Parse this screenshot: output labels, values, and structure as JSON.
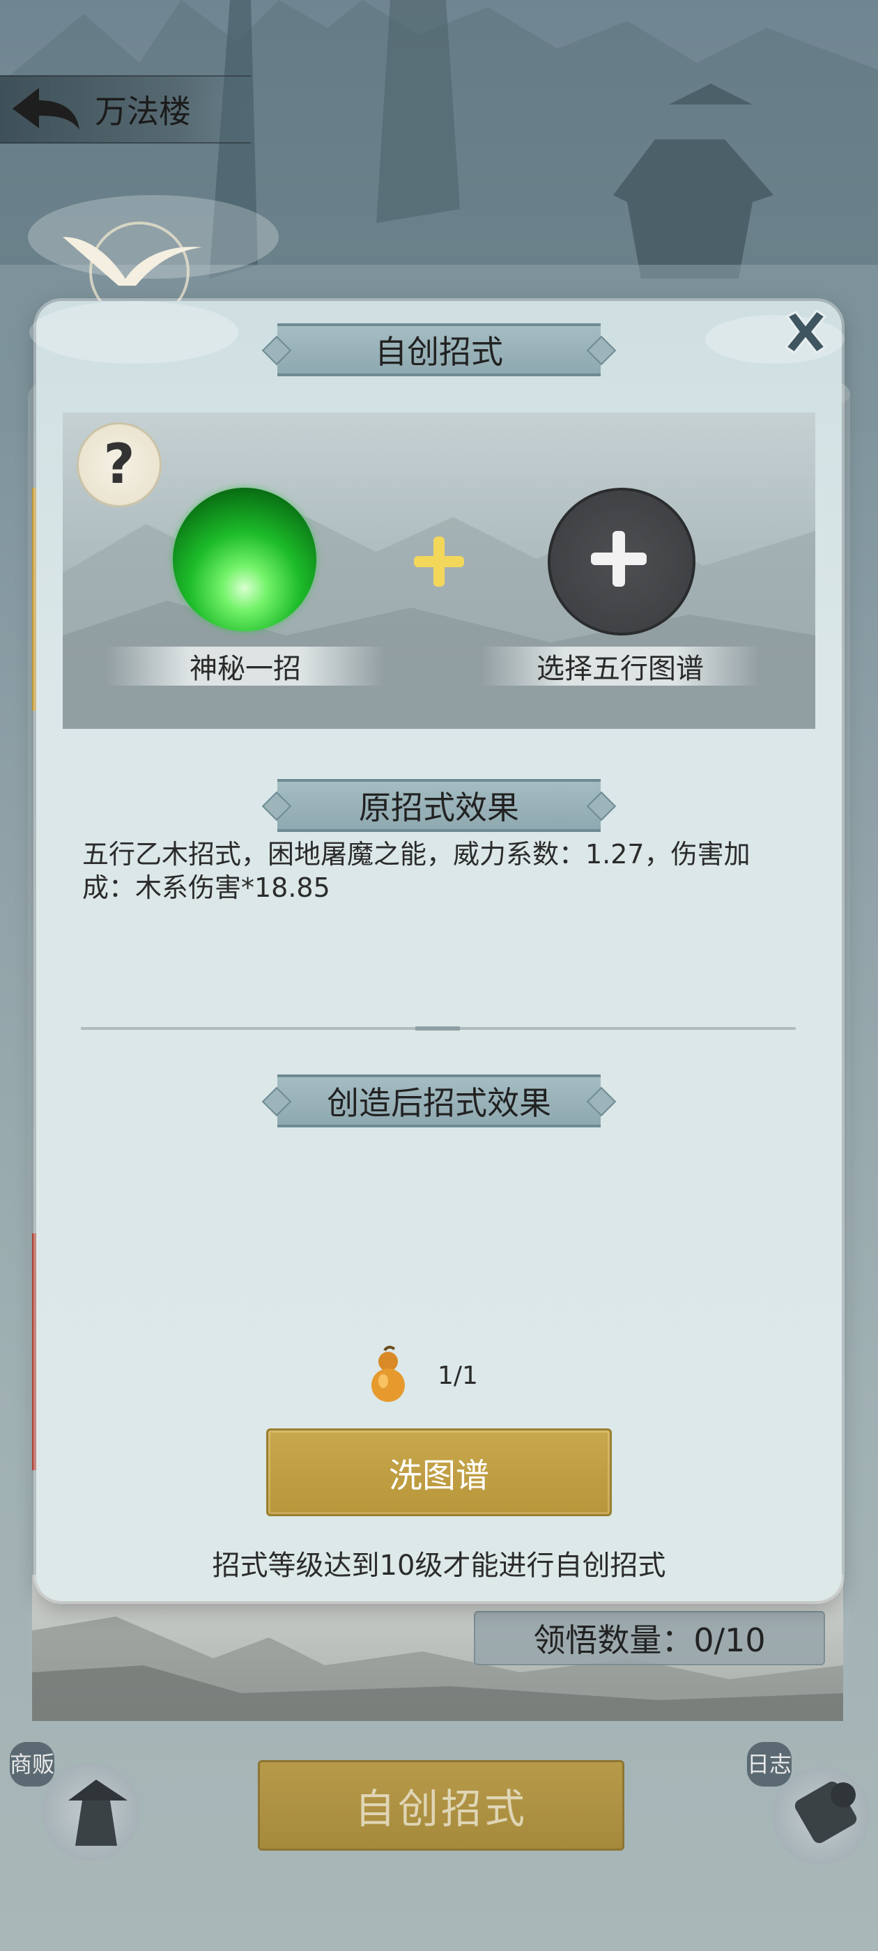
{
  "header": {
    "title": "万法楼"
  },
  "modal": {
    "title": "自创招式",
    "slots": {
      "left_label": "神秘一招",
      "right_label": "选择五行图谱"
    },
    "original_effect": {
      "heading": "原招式效果",
      "text": "五行乙木招式，困地屠魔之能，威力系数：1.27，伤害加成：木系伤害*18.85"
    },
    "created_effect": {
      "heading": "创造后招式效果",
      "text": ""
    },
    "item": {
      "icon": "gourd-icon",
      "count": "1/1"
    },
    "wash_button": "洗图谱",
    "footnote": "招式等级达到10级才能进行自创招式"
  },
  "background": {
    "comprehend_count": "领悟数量：0/10",
    "create_button": "自创招式",
    "left_badge": "商贩",
    "right_badge": "日志"
  },
  "colors": {
    "gold_button": "#c8a84e",
    "ribbon": "#9db4ba",
    "modal_bg": "#dde8e9"
  }
}
